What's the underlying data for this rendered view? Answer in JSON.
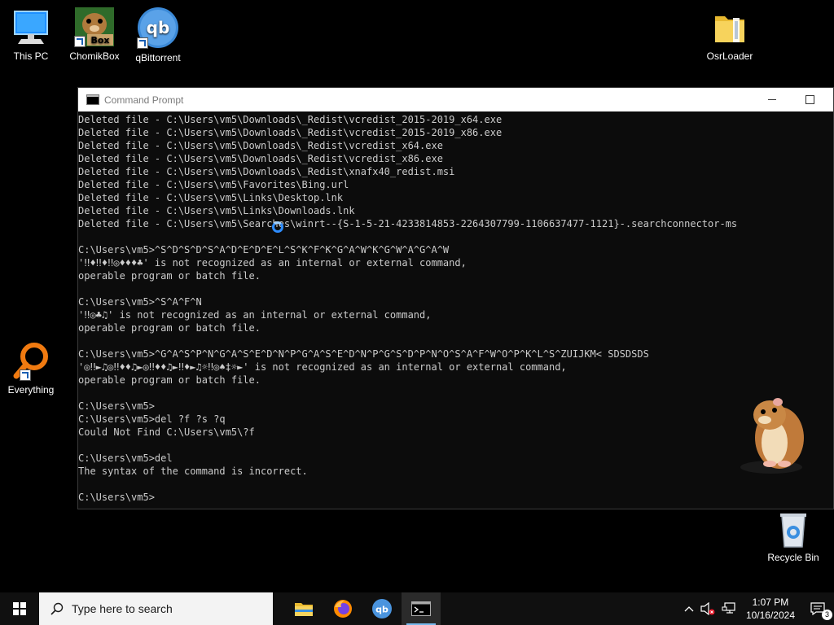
{
  "desktop": {
    "icons": [
      {
        "label": "This PC"
      },
      {
        "label": "ChomikBox"
      },
      {
        "label": "qBittorrent"
      },
      {
        "label": "OsrLoader"
      },
      {
        "label": "Everything"
      },
      {
        "label": "Recycle Bin"
      }
    ],
    "chomikbox_badge": "Box",
    "qbittorrent_badge": "qb"
  },
  "cmd_window": {
    "title": "Command Prompt",
    "lines": [
      "Deleted file - C:\\Users\\vm5\\Downloads\\_Redist\\vcredist_2015-2019_x64.exe",
      "Deleted file - C:\\Users\\vm5\\Downloads\\_Redist\\vcredist_2015-2019_x86.exe",
      "Deleted file - C:\\Users\\vm5\\Downloads\\_Redist\\vcredist_x64.exe",
      "Deleted file - C:\\Users\\vm5\\Downloads\\_Redist\\vcredist_x86.exe",
      "Deleted file - C:\\Users\\vm5\\Downloads\\_Redist\\xnafx40_redist.msi",
      "Deleted file - C:\\Users\\vm5\\Favorites\\Bing.url",
      "Deleted file - C:\\Users\\vm5\\Links\\Desktop.lnk",
      "Deleted file - C:\\Users\\vm5\\Links\\Downloads.lnk",
      "Deleted file - C:\\Users\\vm5\\Searches\\winrt--{S-1-5-21-4233814853-2264307799-1106637477-1121}-.searchconnector-ms",
      "",
      "C:\\Users\\vm5>^S^D^S^D^S^A^D^E^D^E^L^S^K^F^K^G^A^W^K^G^W^A^G^A^W",
      "'‼♦‼♦‼◎♦♦♦♣' is not recognized as an internal or external command,",
      "operable program or batch file.",
      "",
      "C:\\Users\\vm5>^S^A^F^N",
      "'‼◎♣♫' is not recognized as an internal or external command,",
      "operable program or batch file.",
      "",
      "C:\\Users\\vm5>^G^A^S^P^N^G^A^S^E^D^N^P^G^A^S^E^D^N^P^G^S^D^P^N^O^S^A^F^W^O^P^K^L^S^ZUIJKM< SDSDSDS",
      "'◎‼►♫◎‼♦♦♫►◎‼♦♦♫►‼♦►♫☼‼◎♠‡☼►' is not recognized as an internal or external command,",
      "operable program or batch file.",
      "",
      "C:\\Users\\vm5>",
      "C:\\Users\\vm5>del ?f ?s ?q",
      "Could Not Find C:\\Users\\vm5\\?f",
      "",
      "C:\\Users\\vm5>del",
      "The syntax of the command is incorrect.",
      "",
      "C:\\Users\\vm5>"
    ]
  },
  "taskbar": {
    "search_placeholder": "Type here to search",
    "apps": [
      "File Explorer",
      "Firefox",
      "qBittorrent",
      "Command Prompt"
    ],
    "qb_label": "qb",
    "time": "1:07 PM",
    "date": "10/16/2024",
    "notification_count": "3"
  },
  "colors": {
    "console_bg": "#0c0c0c",
    "console_text": "#cccccc",
    "taskbar_bg": "#101010",
    "accent": "#76b9ed"
  }
}
